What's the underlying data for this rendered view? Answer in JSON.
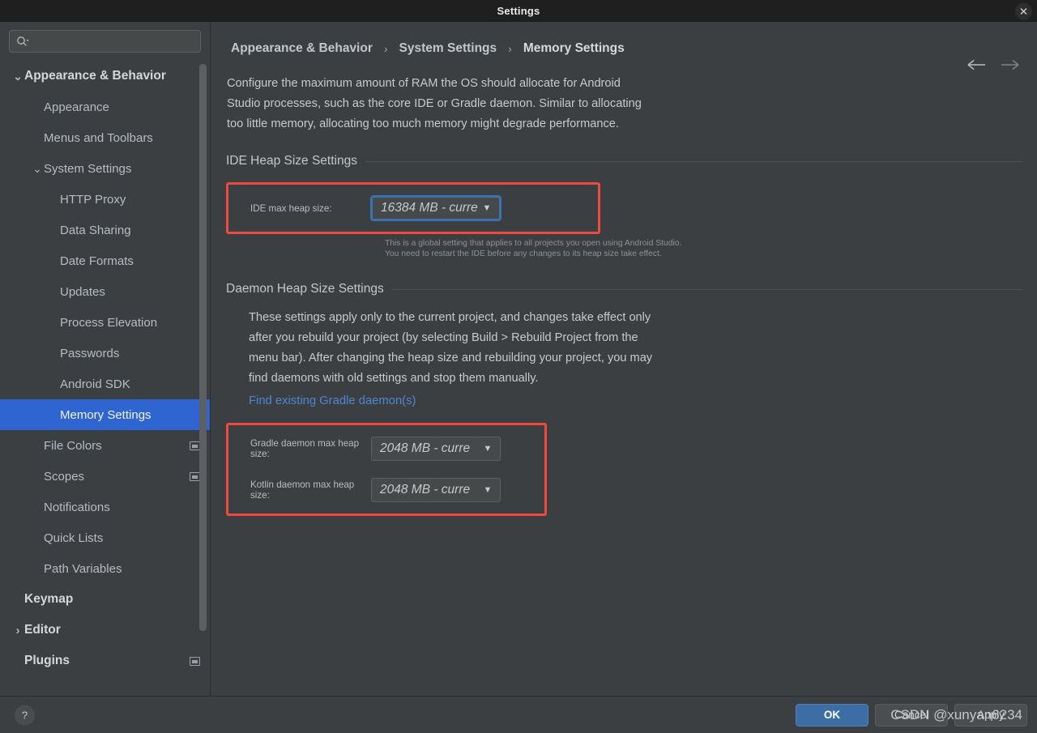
{
  "window": {
    "title": "Settings",
    "close_icon": "close-icon"
  },
  "sidebar": {
    "search": {
      "value": "",
      "placeholder": "",
      "icon": "search-icon"
    },
    "items": [
      {
        "label": "Appearance & Behavior",
        "level": 0,
        "chevron": "chevron-down",
        "bold": true,
        "selected": false,
        "badge": false
      },
      {
        "label": "Appearance",
        "level": 1,
        "chevron": "",
        "bold": false,
        "selected": false,
        "badge": false
      },
      {
        "label": "Menus and Toolbars",
        "level": 1,
        "chevron": "",
        "bold": false,
        "selected": false,
        "badge": false
      },
      {
        "label": "System Settings",
        "level": 1,
        "chevron": "chevron-down",
        "bold": false,
        "selected": false,
        "badge": false
      },
      {
        "label": "HTTP Proxy",
        "level": 2,
        "chevron": "",
        "bold": false,
        "selected": false,
        "badge": false
      },
      {
        "label": "Data Sharing",
        "level": 2,
        "chevron": "",
        "bold": false,
        "selected": false,
        "badge": false
      },
      {
        "label": "Date Formats",
        "level": 2,
        "chevron": "",
        "bold": false,
        "selected": false,
        "badge": false
      },
      {
        "label": "Updates",
        "level": 2,
        "chevron": "",
        "bold": false,
        "selected": false,
        "badge": false
      },
      {
        "label": "Process Elevation",
        "level": 2,
        "chevron": "",
        "bold": false,
        "selected": false,
        "badge": false
      },
      {
        "label": "Passwords",
        "level": 2,
        "chevron": "",
        "bold": false,
        "selected": false,
        "badge": false
      },
      {
        "label": "Android SDK",
        "level": 2,
        "chevron": "",
        "bold": false,
        "selected": false,
        "badge": false
      },
      {
        "label": "Memory Settings",
        "level": 2,
        "chevron": "",
        "bold": false,
        "selected": true,
        "badge": false
      },
      {
        "label": "File Colors",
        "level": 1,
        "chevron": "",
        "bold": false,
        "selected": false,
        "badge": true
      },
      {
        "label": "Scopes",
        "level": 1,
        "chevron": "",
        "bold": false,
        "selected": false,
        "badge": true
      },
      {
        "label": "Notifications",
        "level": 1,
        "chevron": "",
        "bold": false,
        "selected": false,
        "badge": false
      },
      {
        "label": "Quick Lists",
        "level": 1,
        "chevron": "",
        "bold": false,
        "selected": false,
        "badge": false
      },
      {
        "label": "Path Variables",
        "level": 1,
        "chevron": "",
        "bold": false,
        "selected": false,
        "badge": false
      },
      {
        "label": "Keymap",
        "level": 0,
        "chevron": "",
        "bold": true,
        "selected": false,
        "badge": false
      },
      {
        "label": "Editor",
        "level": 0,
        "chevron": "chevron-right",
        "bold": true,
        "selected": false,
        "badge": false
      },
      {
        "label": "Plugins",
        "level": 0,
        "chevron": "",
        "bold": true,
        "selected": false,
        "badge": true
      }
    ]
  },
  "breadcrumb": {
    "items": [
      "Appearance & Behavior",
      "System Settings",
      "Memory Settings"
    ],
    "separator": "›"
  },
  "nav": {
    "back_icon": "arrow-left-icon",
    "forward_icon": "arrow-right-icon"
  },
  "main": {
    "description": "Configure the maximum amount of RAM the OS should allocate for Android Studio processes, such as the core IDE or Gradle daemon. Similar to allocating too little memory, allocating too much memory might degrade performance.",
    "ide_section": {
      "title": "IDE Heap Size Settings",
      "field_label": "IDE max heap size:",
      "field_value": "16384 MB - curre",
      "hint_line1": "This is a global setting that applies to all projects you open using Android Studio.",
      "hint_line2": "You need to restart the IDE before any changes to its heap size take effect."
    },
    "daemon_section": {
      "title": "Daemon Heap Size Settings",
      "description": "These settings apply only to the current project, and changes take effect only after you rebuild your project (by selecting Build > Rebuild Project from the menu bar). After changing the heap size and rebuilding your project, you may find daemons with old settings and stop them manually.",
      "link": "Find existing Gradle daemon(s)",
      "gradle_label": "Gradle daemon max heap size:",
      "gradle_value": "2048 MB - curre",
      "kotlin_label": "Kotlin daemon max heap size:",
      "kotlin_value": "2048 MB - curre"
    }
  },
  "footer": {
    "help_label": "?",
    "ok_label": "OK",
    "cancel_label": "Cancel",
    "apply_label": "Apply",
    "watermark": "CSDN @xunyan6234"
  },
  "colors": {
    "accent_blue": "#2f65d0",
    "highlight_red": "#f04a3f",
    "link_blue": "#4d86d6",
    "primary_button": "#3c6ea5",
    "window_bg": "#3c3f41",
    "titlebar_bg": "#1f1f1f"
  }
}
